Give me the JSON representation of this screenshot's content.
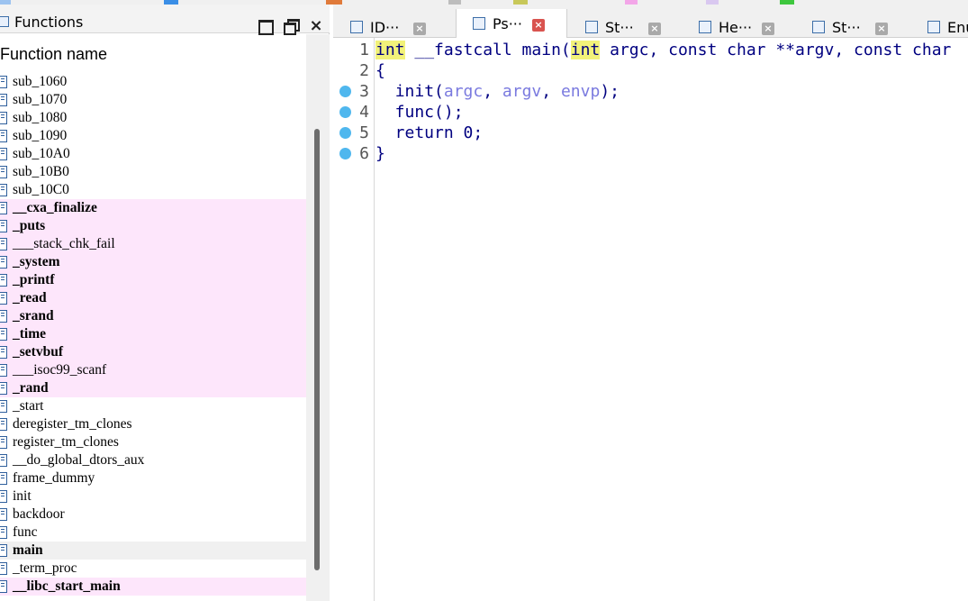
{
  "functions_panel": {
    "title": "Functions",
    "close_glyph": "×",
    "column_header": "Function name",
    "items": [
      {
        "name": "sub_1060",
        "lib": false,
        "bold": false
      },
      {
        "name": "sub_1070",
        "lib": false,
        "bold": false
      },
      {
        "name": "sub_1080",
        "lib": false,
        "bold": false
      },
      {
        "name": "sub_1090",
        "lib": false,
        "bold": false
      },
      {
        "name": "sub_10A0",
        "lib": false,
        "bold": false
      },
      {
        "name": "sub_10B0",
        "lib": false,
        "bold": false
      },
      {
        "name": "sub_10C0",
        "lib": false,
        "bold": false
      },
      {
        "name": "__cxa_finalize",
        "lib": true,
        "bold": true
      },
      {
        "name": "_puts",
        "lib": true,
        "bold": true
      },
      {
        "name": "___stack_chk_fail",
        "lib": true,
        "bold": false
      },
      {
        "name": "_system",
        "lib": true,
        "bold": true
      },
      {
        "name": "_printf",
        "lib": true,
        "bold": true
      },
      {
        "name": "_read",
        "lib": true,
        "bold": true
      },
      {
        "name": "_srand",
        "lib": true,
        "bold": true
      },
      {
        "name": "_time",
        "lib": true,
        "bold": true
      },
      {
        "name": "_setvbuf",
        "lib": true,
        "bold": true
      },
      {
        "name": "___isoc99_scanf",
        "lib": true,
        "bold": false
      },
      {
        "name": "_rand",
        "lib": true,
        "bold": true
      },
      {
        "name": "_start",
        "lib": false,
        "bold": false
      },
      {
        "name": "deregister_tm_clones",
        "lib": false,
        "bold": false
      },
      {
        "name": "register_tm_clones",
        "lib": false,
        "bold": false
      },
      {
        "name": "__do_global_dtors_aux",
        "lib": false,
        "bold": false
      },
      {
        "name": "frame_dummy",
        "lib": false,
        "bold": false
      },
      {
        "name": "init",
        "lib": false,
        "bold": false
      },
      {
        "name": "backdoor",
        "lib": false,
        "bold": false
      },
      {
        "name": "func",
        "lib": false,
        "bold": false
      },
      {
        "name": "main",
        "lib": false,
        "bold": true,
        "selected": true
      },
      {
        "name": "_term_proc",
        "lib": false,
        "bold": false
      },
      {
        "name": "__libc_start_main",
        "lib": true,
        "bold": true
      }
    ]
  },
  "tabs": [
    {
      "label": "ID···",
      "icon": "ida-view-icon",
      "active": false
    },
    {
      "label": "Ps···",
      "icon": "pseudocode-icon",
      "active": true
    },
    {
      "label": "St···",
      "icon": "stack-icon",
      "active": false
    },
    {
      "label": "He···",
      "icon": "hex-view-icon",
      "active": false
    },
    {
      "label": "St···",
      "icon": "strings-icon",
      "active": false
    },
    {
      "label": "Enu",
      "icon": "enums-icon",
      "active": false
    }
  ],
  "tab_close_glyph": "×",
  "pseudocode": {
    "lines": [
      {
        "no": "1",
        "bp": false,
        "text": "int __fastcall main(int argc, const char **argv, const char"
      },
      {
        "no": "2",
        "bp": false,
        "text": "{"
      },
      {
        "no": "3",
        "bp": true,
        "text": "  init(argc, argv, envp);"
      },
      {
        "no": "4",
        "bp": true,
        "text": "  func();"
      },
      {
        "no": "5",
        "bp": true,
        "text": "  return 0;"
      },
      {
        "no": "6",
        "bp": true,
        "text": "}"
      }
    ],
    "line1_parts": {
      "kw1": "int",
      "mid1": " __fastcall main(",
      "kw2": "int",
      "rest": " argc, const char **argv, const char"
    },
    "line3_parts": {
      "fn": "init(",
      "a1": "argc",
      "sep1": ", ",
      "a2": "argv",
      "sep2": ", ",
      "a3": "envp",
      "end": ");"
    }
  },
  "colors": {
    "library_row_bg": "#fde6fb",
    "breakpoint": "#4fb7ee",
    "keyword_highlight": "#f2f27a",
    "code_text": "#000080",
    "variable_text": "#7a7adf"
  }
}
